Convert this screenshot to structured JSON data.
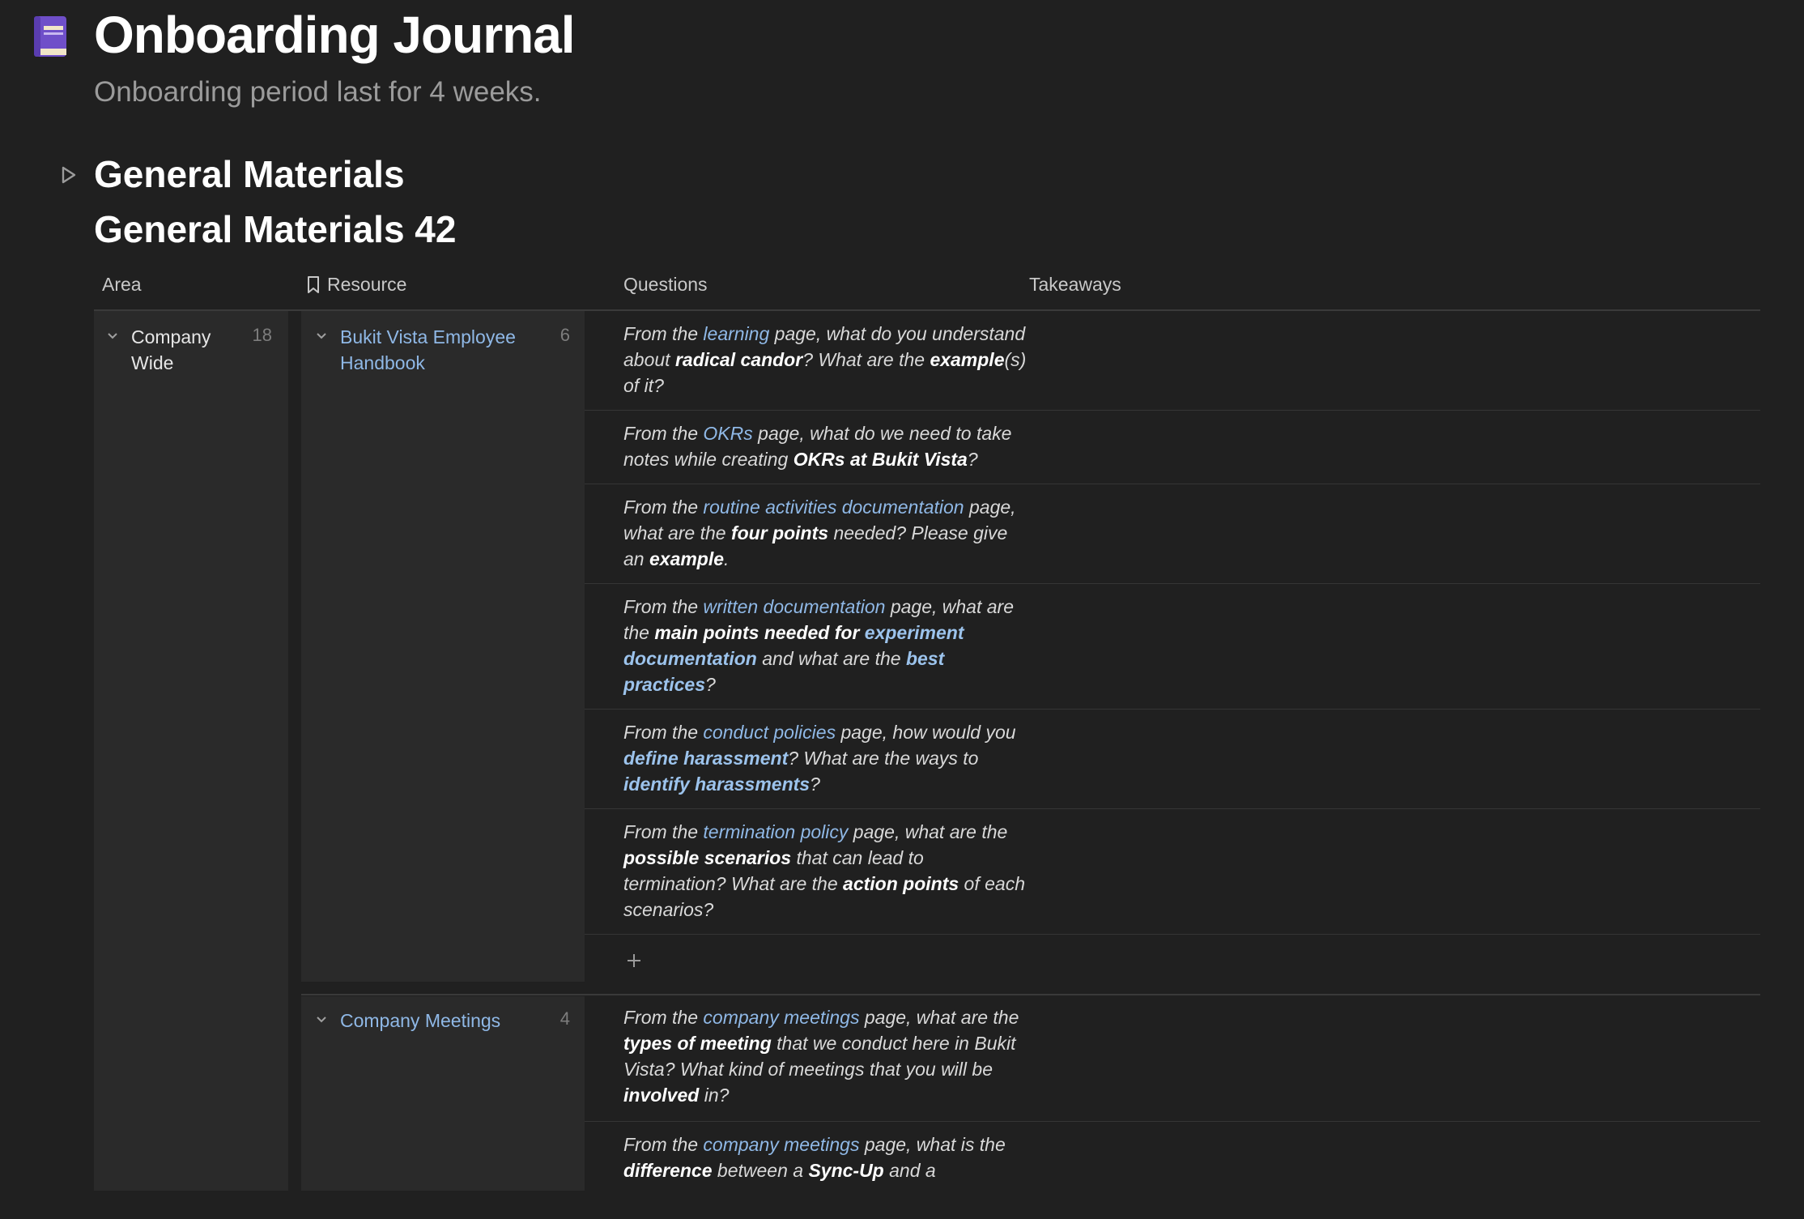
{
  "page": {
    "icon": "book-icon",
    "title": "Onboarding Journal",
    "subtitle": "Onboarding period last for 4 weeks."
  },
  "toggle": {
    "icon": "triangle-right-icon",
    "heading": "General Materials"
  },
  "database": {
    "title": "General Materials 42",
    "columns": [
      {
        "label": "Area"
      },
      {
        "label": "Resource",
        "icon": "bookmark-icon"
      },
      {
        "label": "Questions"
      },
      {
        "label": "Takeaways"
      }
    ],
    "area_groups": [
      {
        "label": "Company Wide",
        "count": "18",
        "resource_groups": [
          {
            "label": "Bukit Vista Employee Handbook",
            "count": "6",
            "rows": [
              [
                [
                  "From the ",
                  "t"
                ],
                [
                  "learning",
                  "l"
                ],
                [
                  " page, what do you understand about ",
                  "t"
                ],
                [
                  "radical candor",
                  "b"
                ],
                [
                  "? What are the ",
                  "t"
                ],
                [
                  "example",
                  "b"
                ],
                [
                  "(s) of it?",
                  "t"
                ]
              ],
              [
                [
                  "From the ",
                  "t"
                ],
                [
                  "OKRs",
                  "l"
                ],
                [
                  " page, what do we need to take notes while creating ",
                  "t"
                ],
                [
                  "OKRs at Bukit Vista",
                  "b"
                ],
                [
                  "?",
                  "t"
                ]
              ],
              [
                [
                  "From the ",
                  "t"
                ],
                [
                  "routine activities documentation",
                  "l"
                ],
                [
                  " page, what are the ",
                  "t"
                ],
                [
                  "four points",
                  "b"
                ],
                [
                  " needed? Please give an ",
                  "t"
                ],
                [
                  "example",
                  "b"
                ],
                [
                  ".",
                  "t"
                ]
              ],
              [
                [
                  "From the ",
                  "t"
                ],
                [
                  "written documentation",
                  "l"
                ],
                [
                  " page, what are the ",
                  "t"
                ],
                [
                  "main points needed for ",
                  "b"
                ],
                [
                  "experiment documentation",
                  "bl"
                ],
                [
                  " and what are the ",
                  "t"
                ],
                [
                  "best practices",
                  "bl"
                ],
                [
                  "?",
                  "t"
                ]
              ],
              [
                [
                  "From the ",
                  "t"
                ],
                [
                  "conduct policies",
                  "l"
                ],
                [
                  " page, how would you ",
                  "t"
                ],
                [
                  "define harassment",
                  "bl"
                ],
                [
                  "? What are the ways to ",
                  "t"
                ],
                [
                  "identify harassments",
                  "bl"
                ],
                [
                  "?",
                  "t"
                ]
              ],
              [
                [
                  "From the ",
                  "t"
                ],
                [
                  "termination policy",
                  "l"
                ],
                [
                  " page, what are the ",
                  "t"
                ],
                [
                  "possible scenarios",
                  "b"
                ],
                [
                  " that can lead to termination? What are the ",
                  "t"
                ],
                [
                  "action points",
                  "b"
                ],
                [
                  " of each scenarios?",
                  "t"
                ]
              ]
            ],
            "add_icon": "plus-icon"
          },
          {
            "label": "Company Meetings",
            "count": "4",
            "rows": [
              [
                [
                  "From the ",
                  "t"
                ],
                [
                  "company meetings",
                  "l"
                ],
                [
                  " page, what are the ",
                  "t"
                ],
                [
                  "types of meeting",
                  "b"
                ],
                [
                  " that we conduct here in Bukit Vista? What kind of meetings that you will be ",
                  "t"
                ],
                [
                  "involved",
                  "b"
                ],
                [
                  " in?",
                  "t"
                ]
              ],
              [
                [
                  "From the ",
                  "t"
                ],
                [
                  "company meetings",
                  "l"
                ],
                [
                  " page, what is the ",
                  "t"
                ],
                [
                  "difference",
                  "b"
                ],
                [
                  " between a ",
                  "t"
                ],
                [
                  "Sync-Up",
                  "b"
                ],
                [
                  " and a ",
                  "t"
                ]
              ]
            ]
          }
        ]
      }
    ]
  }
}
